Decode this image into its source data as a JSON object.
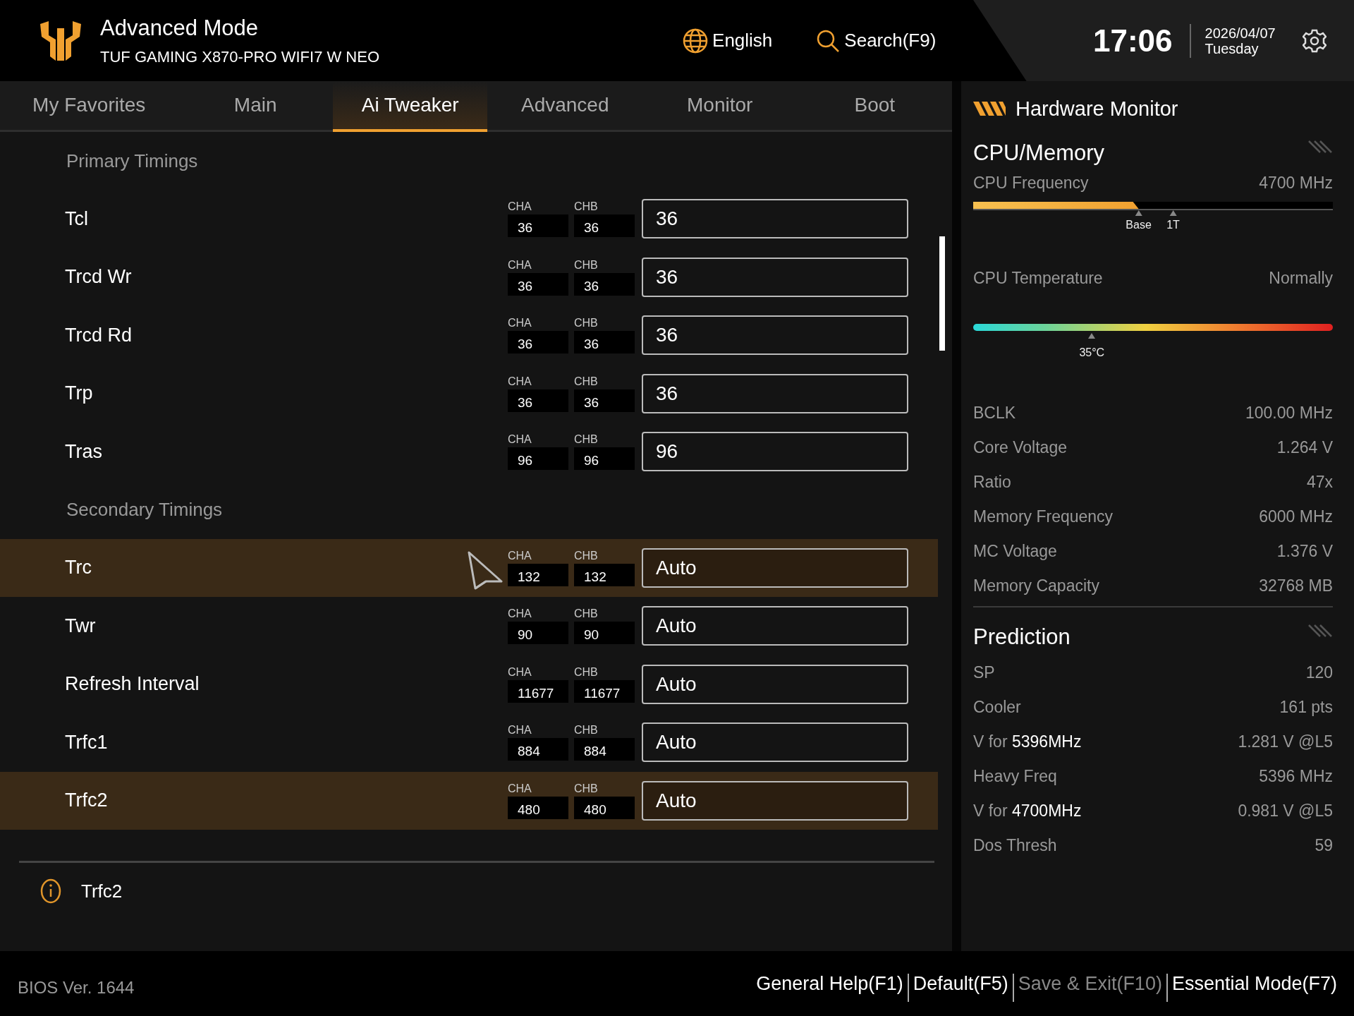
{
  "header": {
    "title": "Advanced Mode",
    "subtitle": "TUF GAMING X870-PRO WIFI7 W NEO",
    "language": "English",
    "search": "Search(F9)",
    "time": "17:06",
    "date": "2026/04/07",
    "weekday": "Tuesday"
  },
  "tabs": [
    {
      "label": "My Favorites",
      "selected": false
    },
    {
      "label": "Main",
      "selected": false
    },
    {
      "label": "Ai Tweaker",
      "selected": true
    },
    {
      "label": "Advanced",
      "selected": false
    },
    {
      "label": "Monitor",
      "selected": false
    },
    {
      "label": "Boot",
      "selected": false
    }
  ],
  "items": [
    {
      "kind": "section",
      "label": "Primary Timings"
    },
    {
      "kind": "setting",
      "label": "Tcl",
      "selected": false,
      "channels": [
        {
          "label": "CHA",
          "value": "36"
        },
        {
          "label": "CHB",
          "value": "36"
        }
      ],
      "value": "36"
    },
    {
      "kind": "setting",
      "label": "Trcd Wr",
      "selected": false,
      "channels": [
        {
          "label": "CHA",
          "value": "36"
        },
        {
          "label": "CHB",
          "value": "36"
        }
      ],
      "value": "36"
    },
    {
      "kind": "setting",
      "label": "Trcd Rd",
      "selected": false,
      "channels": [
        {
          "label": "CHA",
          "value": "36"
        },
        {
          "label": "CHB",
          "value": "36"
        }
      ],
      "value": "36"
    },
    {
      "kind": "setting",
      "label": "Trp",
      "selected": false,
      "channels": [
        {
          "label": "CHA",
          "value": "36"
        },
        {
          "label": "CHB",
          "value": "36"
        }
      ],
      "value": "36"
    },
    {
      "kind": "setting",
      "label": "Tras",
      "selected": false,
      "channels": [
        {
          "label": "CHA",
          "value": "96"
        },
        {
          "label": "CHB",
          "value": "96"
        }
      ],
      "value": "96"
    },
    {
      "kind": "section",
      "label": "Secondary Timings"
    },
    {
      "kind": "setting",
      "label": "Trc",
      "selected": true,
      "pointer": true,
      "channels": [
        {
          "label": "CHA",
          "value": "132"
        },
        {
          "label": "CHB",
          "value": "132"
        }
      ],
      "value": "Auto"
    },
    {
      "kind": "setting",
      "label": "Twr",
      "selected": false,
      "channels": [
        {
          "label": "CHA",
          "value": "90"
        },
        {
          "label": "CHB",
          "value": "90"
        }
      ],
      "value": "Auto"
    },
    {
      "kind": "setting",
      "label": "Refresh Interval",
      "selected": false,
      "channels": [
        {
          "label": "CHA",
          "value": "11677"
        },
        {
          "label": "CHB",
          "value": "11677"
        }
      ],
      "value": "Auto"
    },
    {
      "kind": "setting",
      "label": "Trfc1",
      "selected": false,
      "channels": [
        {
          "label": "CHA",
          "value": "884"
        },
        {
          "label": "CHB",
          "value": "884"
        }
      ],
      "value": "Auto"
    },
    {
      "kind": "setting",
      "label": "Trfc2",
      "selected": true,
      "channels": [
        {
          "label": "CHA",
          "value": "480"
        },
        {
          "label": "CHB",
          "value": "480"
        }
      ],
      "value": "Auto"
    }
  ],
  "help": {
    "text": "Trfc2"
  },
  "monitor": {
    "title": "Hardware Monitor",
    "cpu": {
      "title": "CPU/Memory",
      "frequency": {
        "label": "CPU Frequency",
        "value": "4700 MHz",
        "level": 0.46,
        "markers": [
          "Base",
          "1T"
        ]
      },
      "temperature": {
        "label": "CPU Temperature",
        "status": "Normally",
        "level": 0.33,
        "reading": "35°C"
      },
      "rows": [
        {
          "label": "BCLK",
          "value": "100.00 MHz"
        },
        {
          "label": "Core Voltage",
          "value": "1.264 V"
        },
        {
          "label": "Ratio",
          "value": "47x"
        },
        {
          "label": "Memory Frequency",
          "value": "6000 MHz"
        },
        {
          "label": "MC Voltage",
          "value": "1.376 V"
        },
        {
          "label": "Memory Capacity",
          "value": "32768 MB"
        }
      ]
    },
    "prediction": {
      "title": "Prediction",
      "rows": [
        {
          "label": "SP",
          "value": "120"
        },
        {
          "label": "Cooler",
          "value": "161 pts"
        },
        {
          "label": "V for **5396MHz**",
          "value": "1.281 V @L5"
        },
        {
          "label": "Heavy Freq",
          "value": "5396 MHz"
        },
        {
          "label": "V for **4700MHz**",
          "value": "0.981 V @L5"
        },
        {
          "label": "Dos Thresh",
          "value": "59"
        }
      ]
    }
  },
  "footer": {
    "version": "BIOS Ver. 1644",
    "actions": [
      {
        "label": "General Help(F1)",
        "disabled": false
      },
      {
        "label": "Default(F5)",
        "disabled": false
      },
      {
        "label": "Save & Exit(F10)",
        "disabled": true
      },
      {
        "label": "Essential Mode(F7)",
        "disabled": false
      }
    ]
  }
}
